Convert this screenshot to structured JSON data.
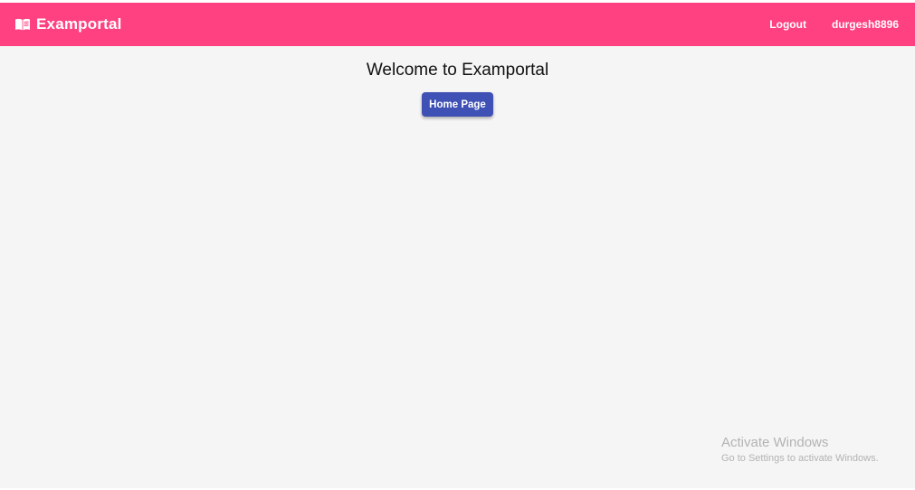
{
  "colors": {
    "navbar": "#ff4081",
    "button": "#3f51b5",
    "background": "#f5f5f5"
  },
  "navbar": {
    "icon": "menu-book-icon",
    "title": "Examportal",
    "links": {
      "logout": "Logout",
      "user": "durgesh8896"
    }
  },
  "main": {
    "heading": "Welcome to Examportal",
    "home_button": "Home Page"
  },
  "watermark": {
    "title": "Activate Windows",
    "subtitle": "Go to Settings to activate Windows."
  }
}
